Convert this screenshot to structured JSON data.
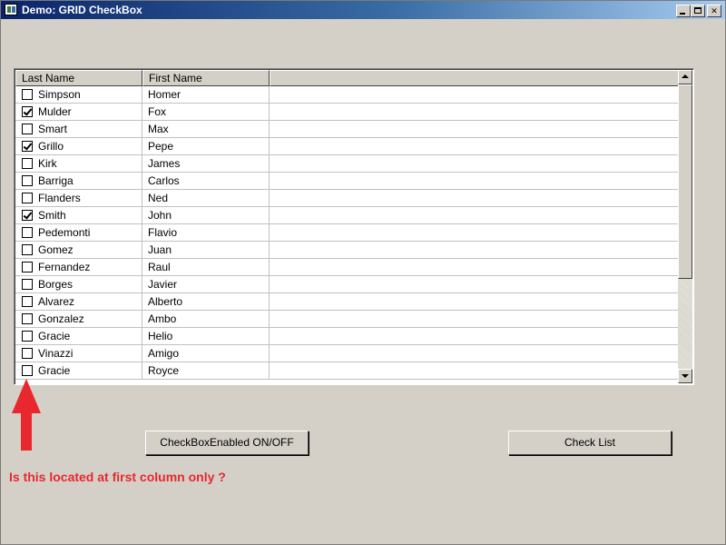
{
  "window": {
    "title": "Demo: GRID CheckBox"
  },
  "grid": {
    "headers": [
      "Last Name",
      "First Name",
      ""
    ],
    "rows": [
      {
        "last": "Simpson",
        "first": "Homer",
        "checked": false
      },
      {
        "last": "Mulder",
        "first": "Fox",
        "checked": true
      },
      {
        "last": "Smart",
        "first": "Max",
        "checked": false
      },
      {
        "last": "Grillo",
        "first": "Pepe",
        "checked": true
      },
      {
        "last": "Kirk",
        "first": "James",
        "checked": false
      },
      {
        "last": "Barriga",
        "first": "Carlos",
        "checked": false
      },
      {
        "last": "Flanders",
        "first": "Ned",
        "checked": false
      },
      {
        "last": "Smith",
        "first": "John",
        "checked": true
      },
      {
        "last": "Pedemonti",
        "first": "Flavio",
        "checked": false
      },
      {
        "last": "Gomez",
        "first": "Juan",
        "checked": false
      },
      {
        "last": "Fernandez",
        "first": "Raul",
        "checked": false
      },
      {
        "last": "Borges",
        "first": "Javier",
        "checked": false
      },
      {
        "last": "Alvarez",
        "first": "Alberto",
        "checked": false
      },
      {
        "last": "Gonzalez",
        "first": "Ambo",
        "checked": false
      },
      {
        "last": "Gracie",
        "first": "Helio",
        "checked": false
      },
      {
        "last": "Vinazzi",
        "first": "Amigo",
        "checked": false
      },
      {
        "last": "Gracie",
        "first": "Royce",
        "checked": false
      }
    ]
  },
  "buttons": {
    "toggle_label": "CheckBoxEnabled ON/OFF",
    "check_list_label": "Check List"
  },
  "annotation": {
    "question": "Is this located at first column only ?",
    "arrow_color": "#e8282c"
  },
  "icons": {
    "app": "grid-app-icon",
    "minimize": "minimize-icon",
    "maximize": "maximize-icon",
    "close": "close-icon"
  }
}
